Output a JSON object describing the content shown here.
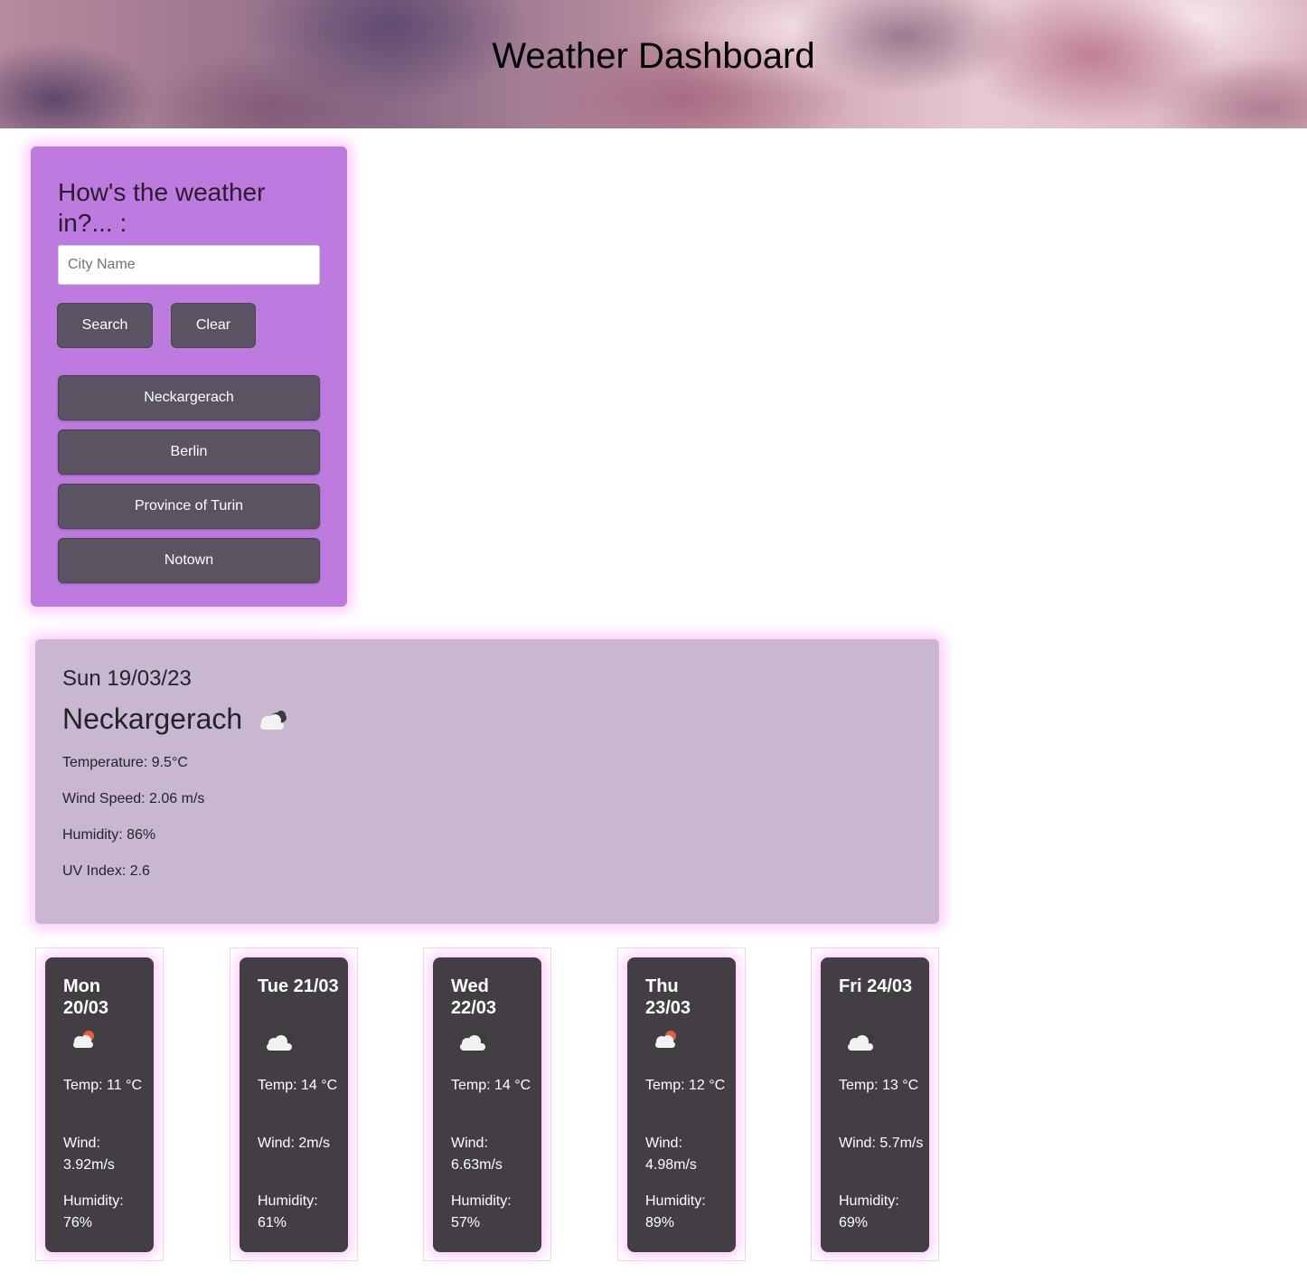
{
  "header": {
    "title": "Weather Dashboard"
  },
  "search": {
    "title": "How's the weather in?... :",
    "placeholder": "City Name",
    "search_label": "Search",
    "clear_label": "Clear",
    "history": [
      "Neckargerach",
      "Berlin",
      "Province of Turin",
      "Notown"
    ]
  },
  "current": {
    "date": "Sun 19/03/23",
    "city": "Neckargerach",
    "icon": "cloudy-icon",
    "temperature": "Temperature: 9.5°C",
    "wind": "Wind Speed: 2.06 m/s",
    "humidity": "Humidity: 86%",
    "uv": "UV Index: 2.6"
  },
  "forecast": [
    {
      "date": "Mon 20/03",
      "icon": "partly-cloudy-sun-icon",
      "temp": "Temp: 11 °C",
      "wind": "Wind: 3.92m/s",
      "humidity": "Humidity: 76%"
    },
    {
      "date": "Tue 21/03",
      "icon": "cloudy-icon",
      "temp": "Temp: 14 °C",
      "wind": "Wind: 2m/s",
      "humidity": "Humidity: 61%"
    },
    {
      "date": "Wed 22/03",
      "icon": "cloudy-icon",
      "temp": "Temp: 14 °C",
      "wind": "Wind: 6.63m/s",
      "humidity": "Humidity: 57%"
    },
    {
      "date": "Thu 23/03",
      "icon": "partly-cloudy-sun-icon",
      "temp": "Temp: 12 °C",
      "wind": "Wind: 4.98m/s",
      "humidity": "Humidity: 89%"
    },
    {
      "date": "Fri 24/03",
      "icon": "cloudy-icon",
      "temp": "Temp: 13 °C",
      "wind": "Wind: 5.7m/s",
      "humidity": "Humidity: 69%"
    }
  ],
  "colors": {
    "search_panel": "#bd7be0",
    "current_panel": "#c9b6d1",
    "forecast_card": "#423e44",
    "button": "#5a5362",
    "glow": "#ffaaff"
  }
}
